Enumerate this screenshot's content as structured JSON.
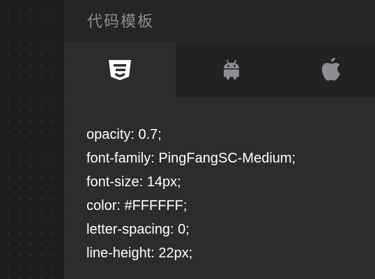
{
  "panel": {
    "title": "代码模板"
  },
  "tabs": [
    {
      "icon": "css3-icon",
      "active": true
    },
    {
      "icon": "android-icon",
      "active": false
    },
    {
      "icon": "apple-icon",
      "active": false
    }
  ],
  "code_lines": [
    "opacity: 0.7;",
    "font-family: PingFangSC-Medium;",
    "font-size: 14px;",
    "color: #FFFFFF;",
    "letter-spacing: 0;",
    "line-height: 22px;"
  ],
  "colors": {
    "background": "#1d1d1e",
    "panel": "#2c2c2e",
    "header": "#252527",
    "tabbar": "#222224",
    "active_icon": "#ffffff",
    "inactive_icon": "#8e8e92"
  }
}
